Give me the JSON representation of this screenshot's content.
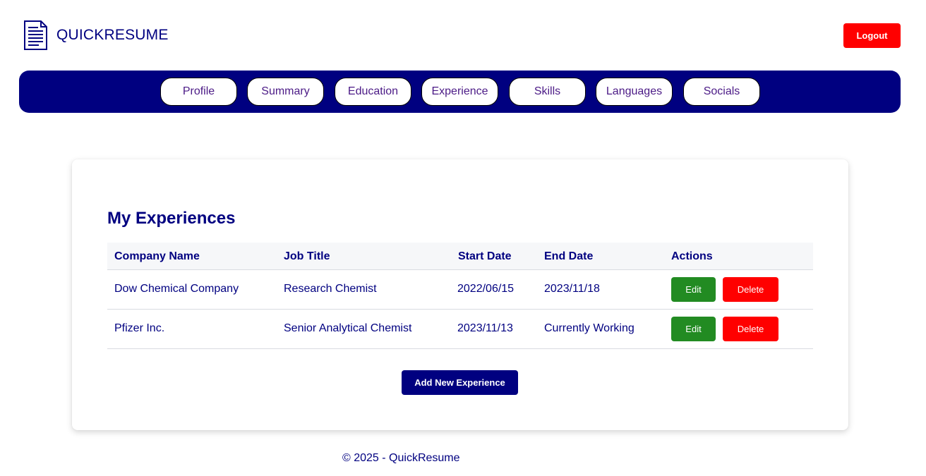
{
  "header": {
    "brand_name": "QUICKRESUME",
    "brand_icon": "document-icon",
    "logout_label": "Logout"
  },
  "nav": {
    "tabs": [
      {
        "label": "Profile"
      },
      {
        "label": "Summary"
      },
      {
        "label": "Education"
      },
      {
        "label": "Experience"
      },
      {
        "label": "Skills"
      },
      {
        "label": "Languages"
      },
      {
        "label": "Socials"
      }
    ]
  },
  "experiences": {
    "title": "My Experiences",
    "columns": [
      "Company Name",
      "Job Title",
      "Start Date",
      "End Date",
      "Actions"
    ],
    "rows": [
      {
        "company": "Dow Chemical Company",
        "job_title": "Research Chemist",
        "start_date": "2022/06/15",
        "end_date": "2023/11/18",
        "edit_label": "Edit",
        "delete_label": "Delete"
      },
      {
        "company": "Pfizer Inc.",
        "job_title": "Senior Analytical Chemist",
        "start_date": "2023/11/13",
        "end_date": "Currently Working",
        "edit_label": "Edit",
        "delete_label": "Delete"
      }
    ],
    "add_label": "Add New Experience"
  },
  "footer": {
    "text": "© 2025 - QuickResume"
  },
  "colors": {
    "primary": "#000080",
    "danger": "#ff0000",
    "success": "#228b22",
    "tab_text": "#4b1a86"
  }
}
